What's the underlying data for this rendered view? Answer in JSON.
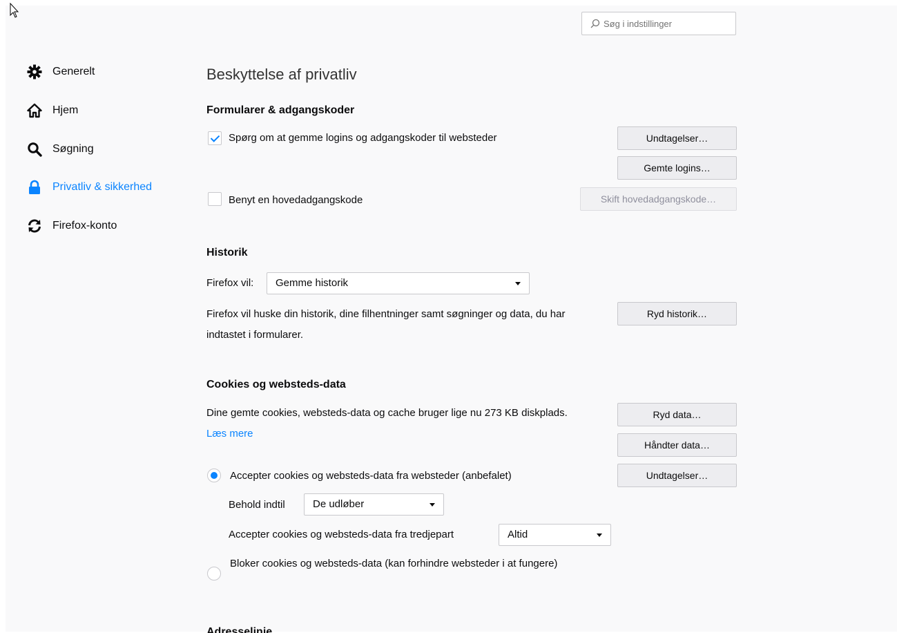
{
  "search": {
    "placeholder": "Søg i indstillinger"
  },
  "sidebar": {
    "items": [
      {
        "label": "Generelt",
        "icon": "gear-icon"
      },
      {
        "label": "Hjem",
        "icon": "home-icon"
      },
      {
        "label": "Søgning",
        "icon": "search-icon"
      },
      {
        "label": "Privatliv & sikkerhed",
        "icon": "lock-icon",
        "active": true
      },
      {
        "label": "Firefox-konto",
        "icon": "sync-icon"
      }
    ]
  },
  "main": {
    "title": "Beskyttelse af privatliv",
    "forms": {
      "heading": "Formularer & adgangskoder",
      "ask_save_logins": {
        "label": "Spørg om at gemme logins og adgangskoder til websteder",
        "checked": true
      },
      "exceptions_button": "Undtagelser…",
      "saved_logins_button": "Gemte logins…",
      "master_password": {
        "label": "Benyt en hovedadgangskode",
        "checked": false
      },
      "change_master_button": "Skift hovedadgangskode…"
    },
    "history": {
      "heading": "Historik",
      "firefox_will_label": "Firefox vil:",
      "mode_value": "Gemme historik",
      "description": "Firefox vil huske din historik, dine filhentninger samt søgninger og data, du har indtastet i formularer.",
      "clear_button": "Ryd historik…"
    },
    "cookies": {
      "heading": "Cookies og websteds-data",
      "usage_text": "Dine gemte cookies, websteds-data og cache bruger lige nu 273 KB diskplads.",
      "learn_more": "Læs mere",
      "clear_button": "Ryd data…",
      "manage_button": "Håndter data…",
      "exceptions_button": "Undtagelser…",
      "accept_radio": {
        "label": "Accepter cookies og websteds-data fra websteder (anbefalet)",
        "checked": true
      },
      "keep_until_label": "Behold indtil",
      "keep_until_value": "De udløber",
      "third_party_label": "Accepter cookies og websteds-data fra tredjepart",
      "third_party_value": "Altid",
      "block_radio": {
        "label": "Bloker cookies og websteds-data (kan forhindre websteder i at fungere)",
        "checked": false
      }
    },
    "next_heading": "Adresselinje"
  },
  "colors": {
    "accent": "#0a84ff",
    "background": "#f9f9fa"
  }
}
